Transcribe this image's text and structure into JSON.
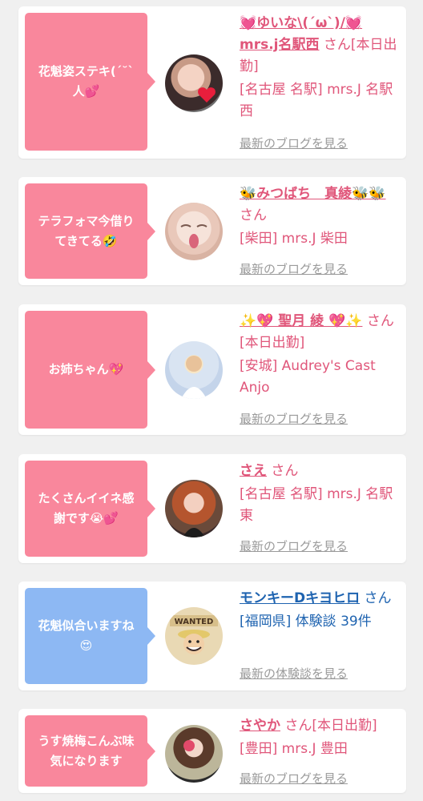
{
  "colors": {
    "pink_bubble": "#f9879c",
    "blue_bubble": "#8db8f3",
    "pink_text": "#e0567a",
    "blue_text": "#1e63b0",
    "link_gray": "#9a9a9a"
  },
  "cards": [
    {
      "comment": "花魁姿ステキ(´˘`人💕",
      "name": "💓ゆいな\\(´ω`)/💓mrs.j名駅西",
      "suffix": "さん[本日出勤]",
      "shop": "[名古屋 名駅] mrs.J 名駅西",
      "link": "最新のブログを見る"
    },
    {
      "comment": "テラフォマ今借りてきてる🤣",
      "name": "🐝みつばち　真綾🐝🐝",
      "suffix": "さん",
      "shop": "[柴田] mrs.J 柴田",
      "link": "最新のブログを見る"
    },
    {
      "comment": "お姉ちゃん💖",
      "name": "✨💖 聖月 綾 💖✨",
      "suffix": "さん[本日出勤]",
      "shop": "[安城] Audrey's Cast Anjo",
      "link": "最新のブログを見る"
    },
    {
      "comment": "たくさんイイネ感謝です😭💕",
      "name": "さえ",
      "suffix": "さん",
      "shop": "[名古屋 名駅] mrs.J 名駅東",
      "link": "最新のブログを見る"
    },
    {
      "comment": "花魁似合いますね😍",
      "name": "モンキーDキヨヒロ",
      "suffix": "さん",
      "shop": "[福岡県] 体験談 39件",
      "link": "最新の体験談を見る"
    },
    {
      "comment": "うす焼梅こんぶ味気になります",
      "name": "さやか",
      "suffix": "さん[本日出勤]",
      "shop": "[豊田] mrs.J 豊田",
      "link": "最新のブログを見る"
    }
  ]
}
